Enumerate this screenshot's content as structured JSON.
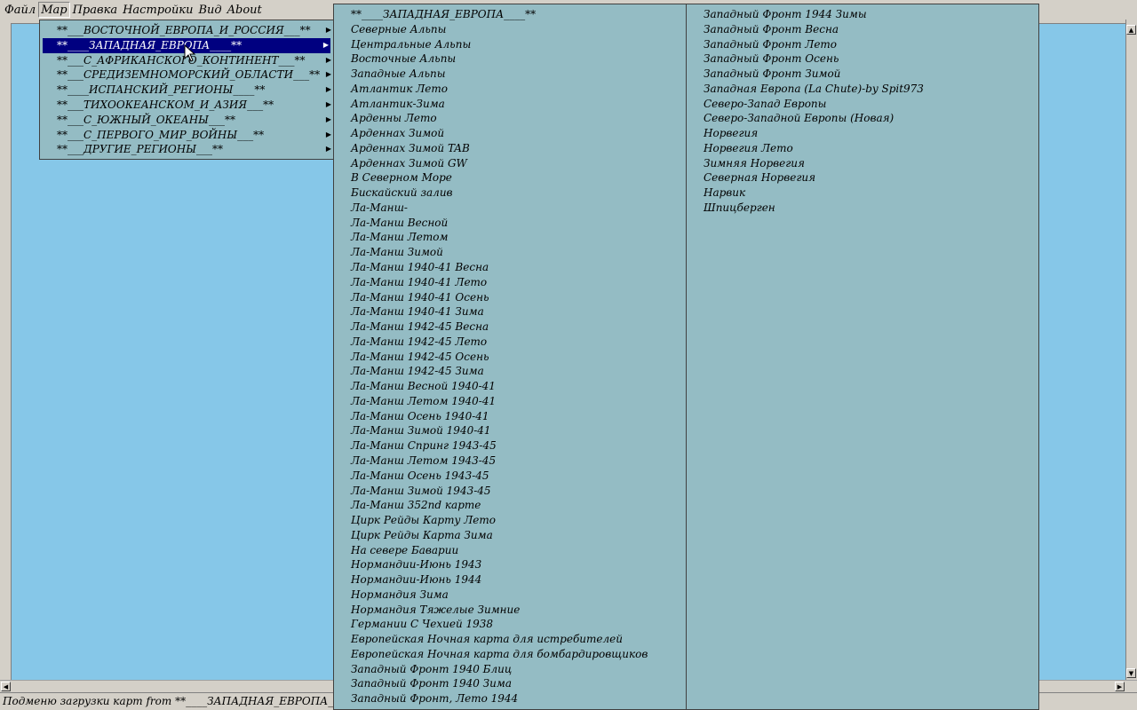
{
  "menubar": {
    "items": [
      "Файл",
      "Мар",
      "Правка",
      "Настройки",
      "Вид",
      "About"
    ],
    "open_index": 1
  },
  "dropdown": {
    "items": [
      "**___ВОСТОЧНОЙ_ЕВРОПА_И_РОССИЯ___**",
      "**____ЗАПАДНАЯ_ЕВРОПА____**",
      "**___С_АФРИКАНСКОГО_КОНТИНЕНТ___**",
      "**___СРЕДИЗЕМНОМОРСКИЙ_ОБЛАСТИ___**",
      "**____ИСПАНСКИЙ_РЕГИОНЫ____**",
      "**___ТИХООКЕАНСКОМ_И_АЗИЯ___**",
      "**___С_ЮЖНЫЙ_ОКЕАНЫ___**",
      "**___С_ПЕРВОГО_МИР_ВОЙНЫ___**",
      "**___ДРУГИЕ_РЕГИОНЫ___**"
    ],
    "selected_index": 1
  },
  "submenu_col1": [
    "**____ЗАПАДНАЯ_ЕВРОПА____**",
    "Северные Альпы",
    "Центральные Альпы",
    "Восточные Альпы",
    "Западные Альпы",
    "Атлантик Лето",
    "Атлантик-Зима",
    "Арденны Лето",
    "Арденнах Зимой",
    "Арденнах Зимой TAB",
    "Арденнах Зимой   GW",
    "В Северном Море",
    "Бискайский залив",
    "Ла-Манш-",
    "Ла-Манш Весной",
    "Ла-Манш Летом",
    "Ла-Манш Зимой",
    "Ла-Манш 1940-41 Весна",
    "Ла-Манш 1940-41 Лето",
    "Ла-Манш 1940-41 Осень",
    "Ла-Манш 1940-41 Зима",
    "Ла-Манш 1942-45 Весна",
    "Ла-Манш 1942-45 Лето",
    "Ла-Манш 1942-45 Осень",
    "Ла-Манш 1942-45 Зима",
    "Ла-Манш Весной 1940-41",
    "Ла-Манш Летом 1940-41",
    "Ла-Манш Осень 1940-41",
    "Ла-Манш Зимой 1940-41",
    "Ла-Манш Спринг 1943-45",
    "Ла-Манш Летом 1943-45",
    "Ла-Манш Осень 1943-45",
    "Ла-Манш Зимой 1943-45",
    "Ла-Манш 352nd карте",
    "Цирк Рейды Карту Лето",
    "Цирк Рейды Карта Зима",
    "На севере Баварии",
    "Нормандии-Июнь 1943",
    "Нормандии-Июнь 1944",
    "Нормандия Зима",
    "Нормандия Тяжелые Зимние",
    "Германии С Чехией 1938",
    "Европейская Ночная карта для истребителей",
    "Европейская Ночная карта для бомбардировщиков",
    "Западный Фронт 1940 Блиц",
    "Западный Фронт 1940 Зима",
    "Западный Фронт, Лето 1944"
  ],
  "submenu_col2": [
    "Западный Фронт 1944 Зимы",
    "Западный Фронт Весна",
    "Западный Фронт Лето",
    "Западный Фронт Осень",
    "Западный Фронт Зимой",
    "Западная Европа (La Chute)-by Spit973",
    "Северо-Запад Европы",
    "Северо-Западной Европы (Новая)",
    "Норвегия",
    "Норвегия Лето",
    "Зимняя Норвегия",
    "Северная Норвегия",
    "Нарвик",
    "Шпицберген"
  ],
  "statusbar": {
    "text": "Подменю загрузки карт from **____ЗАПАДНАЯ_ЕВРОПА____**"
  },
  "colors": {
    "canvas": "#86c7e8",
    "menu_bg": "#94bcc4",
    "selection": "#000080",
    "chrome": "#d4d0c8"
  },
  "icons": {
    "submenu_arrow": "triangle-right-icon",
    "cursor": "mouse-pointer-icon"
  }
}
